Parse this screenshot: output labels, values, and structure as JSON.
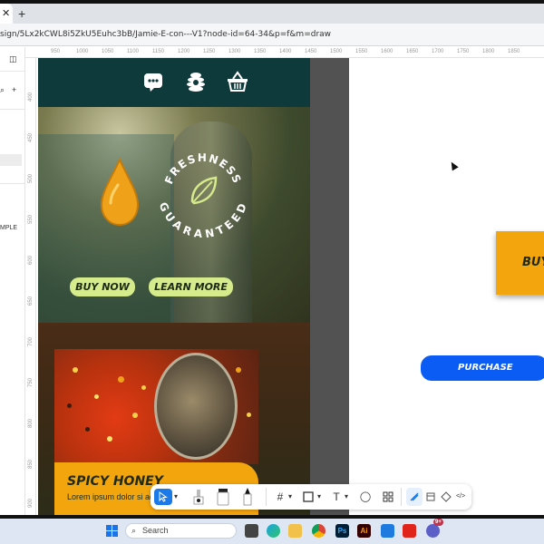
{
  "browser": {
    "tab_close_glyph": "✕",
    "new_tab_glyph": "+",
    "url": "sign/5Lx2kCWL8i5ZkU5Euhc3bB/Jamie-E-con---V1?node-id=64-34&p=f&m=draw"
  },
  "left_panel": {
    "layers_glyph": "◫",
    "search_glyph": "⌕",
    "add_glyph": "+",
    "item_label": "MPLE"
  },
  "ruler": {
    "marks": [
      "950",
      "1000",
      "1050",
      "1100",
      "1150",
      "1200",
      "1250",
      "1300",
      "1350",
      "1400",
      "1450",
      "1500",
      "1550",
      "1600",
      "1650",
      "1700",
      "1750",
      "1800",
      "1850"
    ],
    "vmarks": [
      "400",
      "450",
      "500",
      "550",
      "600",
      "650",
      "700",
      "750",
      "800",
      "850",
      "900"
    ]
  },
  "design": {
    "badge_top": "FRESHNESS",
    "badge_bottom": "GUARANTEED",
    "buy_now": "BUY NOW",
    "learn_more": "LEARN MORE",
    "card_title": "SPICY HONEY",
    "card_body": "Lorem ipsum dolor si adipiscing elit, sed do eiu",
    "card_body_trail": "...",
    "colors": {
      "nav": "#0e3a3c",
      "button": "#d6eb8c",
      "card": "#f3a50d",
      "drop": "#f0a11a"
    }
  },
  "canvas": {
    "buy_card_text": "BUY",
    "purchase_label": "PURCHASE",
    "purchase_color": "#0b5cf5"
  },
  "toolbar": {
    "items": [
      "move-tool",
      "pen-tool",
      "pencil-tool",
      "marker-tool",
      "frame-tool",
      "shape-tool",
      "text-tool",
      "comment-tool",
      "components-tool",
      "design-mode",
      "dev-mode",
      "code-view"
    ],
    "text_glyph": "T",
    "frame_glyph": "#",
    "comment_glyph": "◯",
    "code_glyph": "</>"
  },
  "taskbar": {
    "search_label": "Search",
    "icons": [
      "task-view",
      "edge",
      "file-explorer",
      "chrome",
      "photoshop",
      "illustrator",
      "remote-desktop",
      "acrobat",
      "teams"
    ],
    "photoshop_label": "Ps",
    "illustrator_label": "Ai",
    "teams_badge": "9+"
  }
}
